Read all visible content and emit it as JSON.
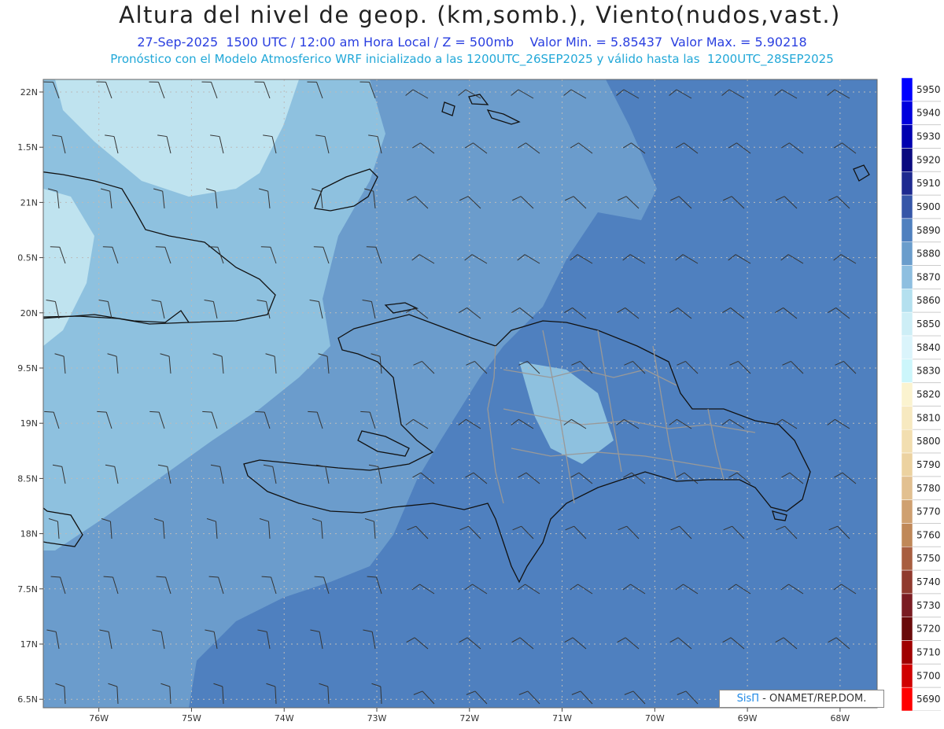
{
  "header": {
    "title": "Altura del nivel de geop. (km,somb.), Viento(nudos,vast.)",
    "subtitle_line1": "27-Sep-2025  1500 UTC / 12:00 am Hora Local / Z = 500mb    Valor Min. = 5.85437  Valor Max. = 5.90218",
    "subtitle_line2": "Pronóstico con el Modelo Atmosferico WRF inicializado a las 1200UTC_26SEP2025 y válido hasta las  1200UTC_28SEP2025"
  },
  "axes": {
    "lat_labels": [
      "22N",
      "1.5N",
      "21N",
      "0.5N",
      "20N",
      "9.5N",
      "19N",
      "8.5N",
      "18N",
      "7.5N",
      "17N",
      "6.5N"
    ],
    "lon_labels": [
      "76W",
      "75W",
      "74W",
      "73W",
      "72W",
      "71W",
      "70W",
      "69W",
      "68W"
    ],
    "lat_range": [
      16.5,
      22
    ],
    "lon_range": [
      -76.6,
      -67.6
    ]
  },
  "legend": {
    "levels": [
      5950,
      5940,
      5930,
      5920,
      5910,
      5900,
      5890,
      5880,
      5870,
      5860,
      5850,
      5840,
      5830,
      5820,
      5810,
      5800,
      5790,
      5780,
      5770,
      5760,
      5750,
      5740,
      5730,
      5720,
      5710,
      5700,
      5690
    ],
    "colors": [
      "#0000ff",
      "#0000dd",
      "#0000b0",
      "#0a0a80",
      "#1e2a90",
      "#3656a8",
      "#4f80bf",
      "#6a9dcc",
      "#8ebfe0",
      "#b4e0ef",
      "#cdeef6",
      "#daf4fb",
      "#ccf6fb",
      "#fbf3cf",
      "#f7e9c0",
      "#f2deb0",
      "#ecd2a0",
      "#e2c090",
      "#cfa070",
      "#c08858",
      "#a85e40",
      "#903a2e",
      "#7a1c22",
      "#6a0a0a",
      "#a00000",
      "#d00000",
      "#ff0000"
    ]
  },
  "credit": {
    "brand": "SisΠ",
    "org": " - ONAMET/REP.DOM."
  },
  "colors": {
    "field_low": "#bfe3ef",
    "field_mid": "#8ec1df",
    "field_midhigh": "#6b9ccc",
    "field_high": "#4f80bf",
    "grid": "#bbbbbb"
  }
}
